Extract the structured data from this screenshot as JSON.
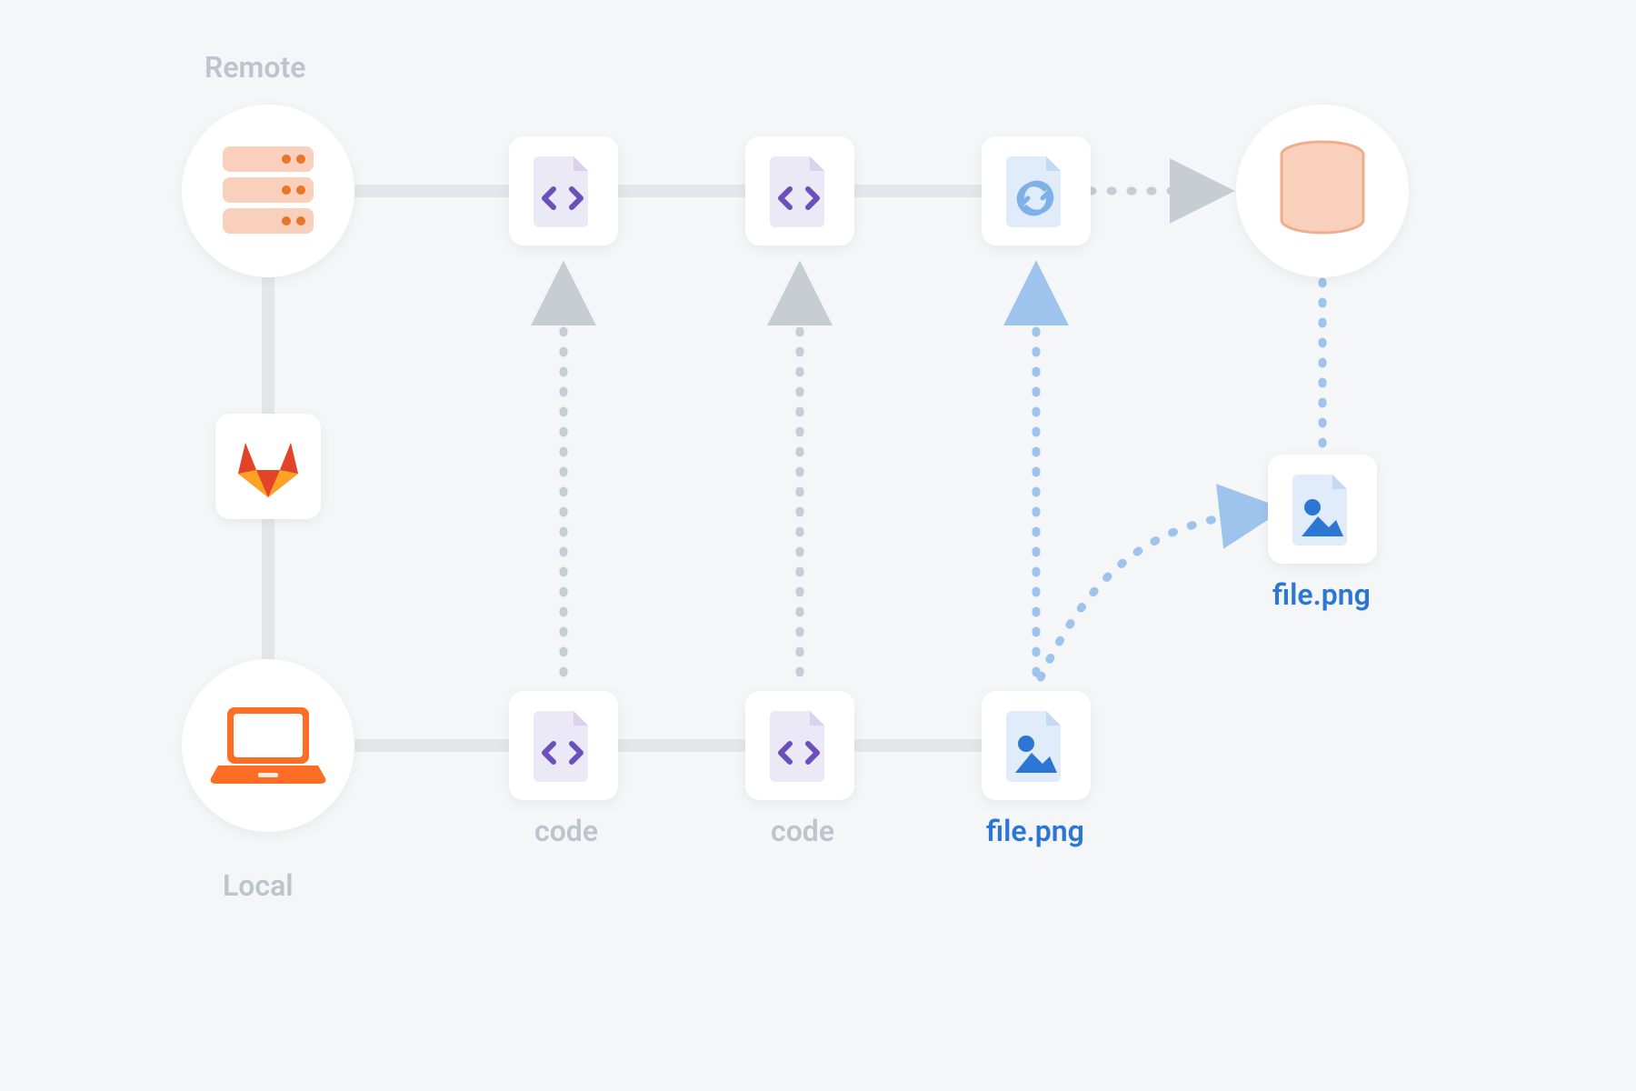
{
  "labels": {
    "remote": "Remote",
    "local": "Local",
    "code1": "code",
    "code2": "code",
    "file_local": "file.png",
    "file_remote": "file.png"
  },
  "colors": {
    "bg": "#f5f6f7",
    "grey_text": "#bfc4cc",
    "blue_text": "#2d77d4",
    "connector_grey": "#e4e6ea",
    "dashed_grey": "#c8ccd3",
    "dashed_blue": "#9ec3ec",
    "server_fill": "#f8d0bc",
    "server_stroke": "#f0a884",
    "server_dot": "#e7762b",
    "orange": "#fc6d26",
    "code_page": "#ece9f7",
    "code_fold": "#d8d2ef",
    "code_glyph": "#6b4fbb",
    "sync_page": "#e1ecfa",
    "sync_fold": "#c4d9f4",
    "sync_glyph": "#7fb0e6",
    "img_page": "#e1ecfa",
    "img_fold": "#c4d9f4",
    "img_glyph": "#2d77d4",
    "db_fill": "#f8d0bc",
    "db_stroke": "#f0ad8c"
  },
  "layout_description": "Two rows (Remote top, Local bottom) linked by a vertical path with a GitLab badge. Each row has a round hub on the left connected by a horizontal grey bar to three file cards. Dashed grey arrows rise from the two local code cards to the remote code cards. A dashed blue arrow rises from the local image card to a remote sync card, and a dashed blue curve goes from the local image card to a second image card on the right, which is itself linked by a dashed blue vertical to a database hub above it. A dashed grey arrow connects the remote sync card to the database hub."
}
